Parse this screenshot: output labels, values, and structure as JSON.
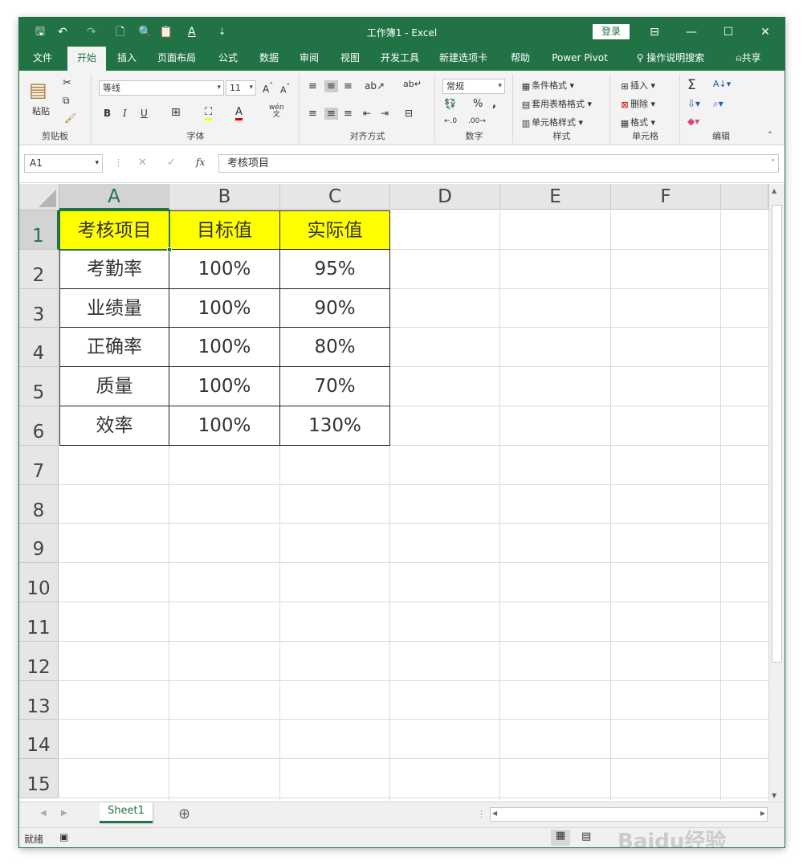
{
  "window": {
    "title": "工作簿1 - Excel",
    "login": "登录"
  },
  "quick_access": {
    "save": "🖫",
    "undo": "↶",
    "redo": "↷",
    "new": "🗋",
    "preview": "🔍",
    "paste": "📋",
    "font_color": "A",
    "customize": "⇣"
  },
  "window_controls": {
    "ribbon_display": "⊟",
    "minimize": "—",
    "maximize": "☐",
    "close": "✕"
  },
  "tabs": [
    "文件",
    "开始",
    "插入",
    "页面布局",
    "公式",
    "数据",
    "审阅",
    "视图",
    "开发工具",
    "新建选项卡",
    "帮助",
    "Power Pivot",
    "操作说明搜索",
    "共享"
  ],
  "active_tab": "开始",
  "ribbon": {
    "clipboard": {
      "paste": "粘贴",
      "label": "剪贴板"
    },
    "font": {
      "name": "等线",
      "size": "11",
      "bold": "B",
      "italic": "I",
      "underline": "U",
      "wen": "wén",
      "label": "字体"
    },
    "alignment": {
      "label": "对齐方式"
    },
    "number": {
      "format": "常规",
      "percent": "%",
      "comma": ",",
      "label": "数字"
    },
    "styles": {
      "conditional": "条件格式",
      "table": "套用表格格式",
      "cell_styles": "单元格样式",
      "label": "样式"
    },
    "cells": {
      "insert": "插入",
      "delete": "删除",
      "format": "格式",
      "label": "单元格"
    },
    "editing": {
      "sum": "Σ",
      "label": "编辑"
    }
  },
  "formula_bar": {
    "name_box": "A1",
    "fx": "fx",
    "content": "考核项目"
  },
  "columns": [
    "A",
    "B",
    "C",
    "D",
    "E",
    "F"
  ],
  "rows": [
    "1",
    "2",
    "3",
    "4",
    "5",
    "6",
    "7",
    "8",
    "9",
    "10",
    "11",
    "12",
    "13",
    "14",
    "15"
  ],
  "table": {
    "headers": [
      "考核项目",
      "目标值",
      "实际值"
    ],
    "rows": [
      [
        "考勤率",
        "100%",
        "95%"
      ],
      [
        "业绩量",
        "100%",
        "90%"
      ],
      [
        "正确率",
        "100%",
        "80%"
      ],
      [
        "质量",
        "100%",
        "70%"
      ],
      [
        "效率",
        "100%",
        "130%"
      ]
    ]
  },
  "sheet": {
    "tab": "Sheet1",
    "add": "⊕"
  },
  "status": {
    "ready": "就绪"
  },
  "watermark": "Baidu经验",
  "colors": {
    "excel_green": "#217346",
    "header_fill": "#ffff00"
  }
}
